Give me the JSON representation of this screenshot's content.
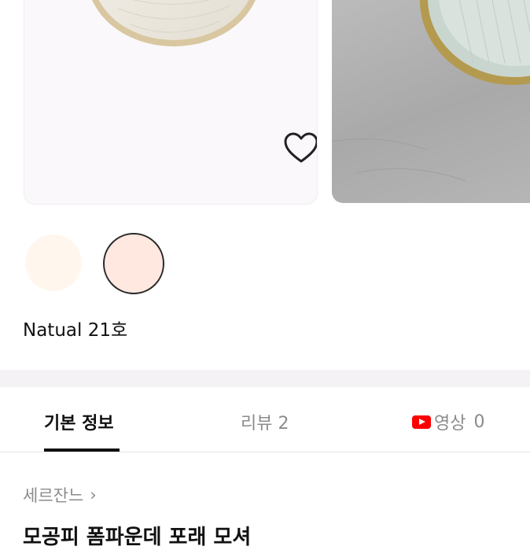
{
  "product_images": [
    {
      "name": "cushion compact on white background",
      "icon": "wishlist-heart-icon"
    },
    {
      "name": "cushion compact on gray leather"
    }
  ],
  "color_options": {
    "swatches": [
      {
        "color": "#fff6ee",
        "selected": false
      },
      {
        "color": "#ffe8e0",
        "selected": true
      }
    ],
    "selected_name": "Natual 21호"
  },
  "tabs": {
    "basic_info": "기본 정보",
    "reviews": {
      "label": "리뷰",
      "count": "2"
    },
    "video": {
      "label": "영상",
      "count": "0",
      "icon": "youtube-icon"
    },
    "active": "basic_info",
    "accent_color": "#111111",
    "video_icon_color": "#ff0000"
  },
  "product": {
    "brand": "세르잔느",
    "brand_chevron": "›",
    "title": "모공피 폼파운데 포래 모셔"
  }
}
